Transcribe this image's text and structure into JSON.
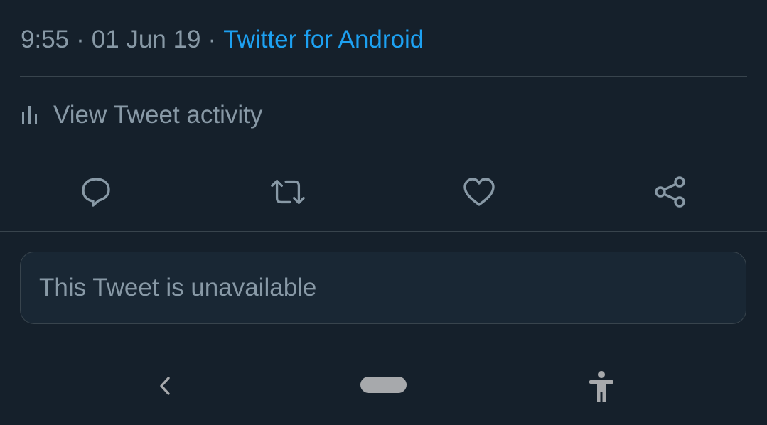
{
  "tweet_meta": {
    "time": "9:55",
    "separator": "·",
    "date": "01 Jun 19",
    "source": "Twitter for Android"
  },
  "activity": {
    "icon": "bar-chart-icon",
    "label": "View Tweet activity"
  },
  "actions": [
    {
      "name": "reply",
      "icon": "reply-icon"
    },
    {
      "name": "retweet",
      "icon": "retweet-icon"
    },
    {
      "name": "like",
      "icon": "heart-icon"
    },
    {
      "name": "share",
      "icon": "share-icon"
    }
  ],
  "quoted_tweet": {
    "text": "This Tweet is unavailable"
  },
  "system_nav": {
    "back_icon": "chevron-left-icon",
    "home_icon": "home-pill-icon",
    "accessibility_icon": "accessibility-icon"
  },
  "colors": {
    "background": "#15202b",
    "text_secondary": "#8899a6",
    "accent": "#1da1f2",
    "divider": "#38444d",
    "card_background": "#192734"
  }
}
